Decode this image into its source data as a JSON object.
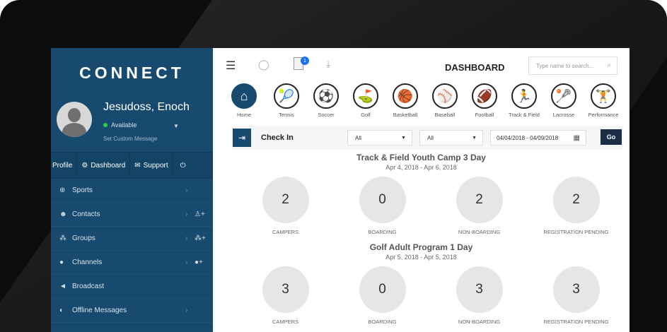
{
  "brand": "CONNECT",
  "profile": {
    "name": "Jesudoss, Enoch",
    "status": "Available",
    "custom_message": "Set Custom Message"
  },
  "tabs": [
    "Profile",
    "Dashboard",
    "Support"
  ],
  "menu": [
    {
      "label": "Sports",
      "icon": "globe-icon"
    },
    {
      "label": "Contacts",
      "icon": "contacts-icon"
    },
    {
      "label": "Groups",
      "icon": "groups-icon"
    },
    {
      "label": "Channels",
      "icon": "channels-icon"
    },
    {
      "label": "Broadcast",
      "icon": "broadcast-icon"
    },
    {
      "label": "Offline Messages",
      "icon": "offline-messages-icon"
    }
  ],
  "topbar": {
    "title": "DASHBOARD",
    "search_placeholder": "Type name to search...",
    "notification_count": "1"
  },
  "sports": [
    "Home",
    "Tennis",
    "Soccer",
    "Golf",
    "Basketball",
    "Baseball",
    "Football",
    "Track & Field",
    "Lacrosse",
    "Performance"
  ],
  "checkin": {
    "label": "Check In",
    "filter1": "All",
    "filter2": "All",
    "date_range": "04/04/2018 - 04/09/2018",
    "go_label": "Go"
  },
  "camps": [
    {
      "title": "Track & Field Youth Camp 3 Day",
      "dates": "Apr 4, 2018 - Apr 6, 2018",
      "stats": [
        {
          "value": "2",
          "label": "CAMPERS"
        },
        {
          "value": "0",
          "label": "BOARDING"
        },
        {
          "value": "2",
          "label": "NON-BOARDING"
        },
        {
          "value": "2",
          "label": "REGISTRATION PENDING"
        }
      ]
    },
    {
      "title": "Golf Adult Program 1 Day",
      "dates": "Apr 5, 2018 - Apr 5, 2018",
      "stats": [
        {
          "value": "3",
          "label": "CAMPERS"
        },
        {
          "value": "0",
          "label": "BOARDING"
        },
        {
          "value": "3",
          "label": "NON-BOARDING"
        },
        {
          "value": "3",
          "label": "REGISTRATION PENDING"
        }
      ]
    }
  ],
  "colors": {
    "sidebar": "#174a6e",
    "accent": "#1a2f47",
    "badge": "#1a73e8"
  }
}
